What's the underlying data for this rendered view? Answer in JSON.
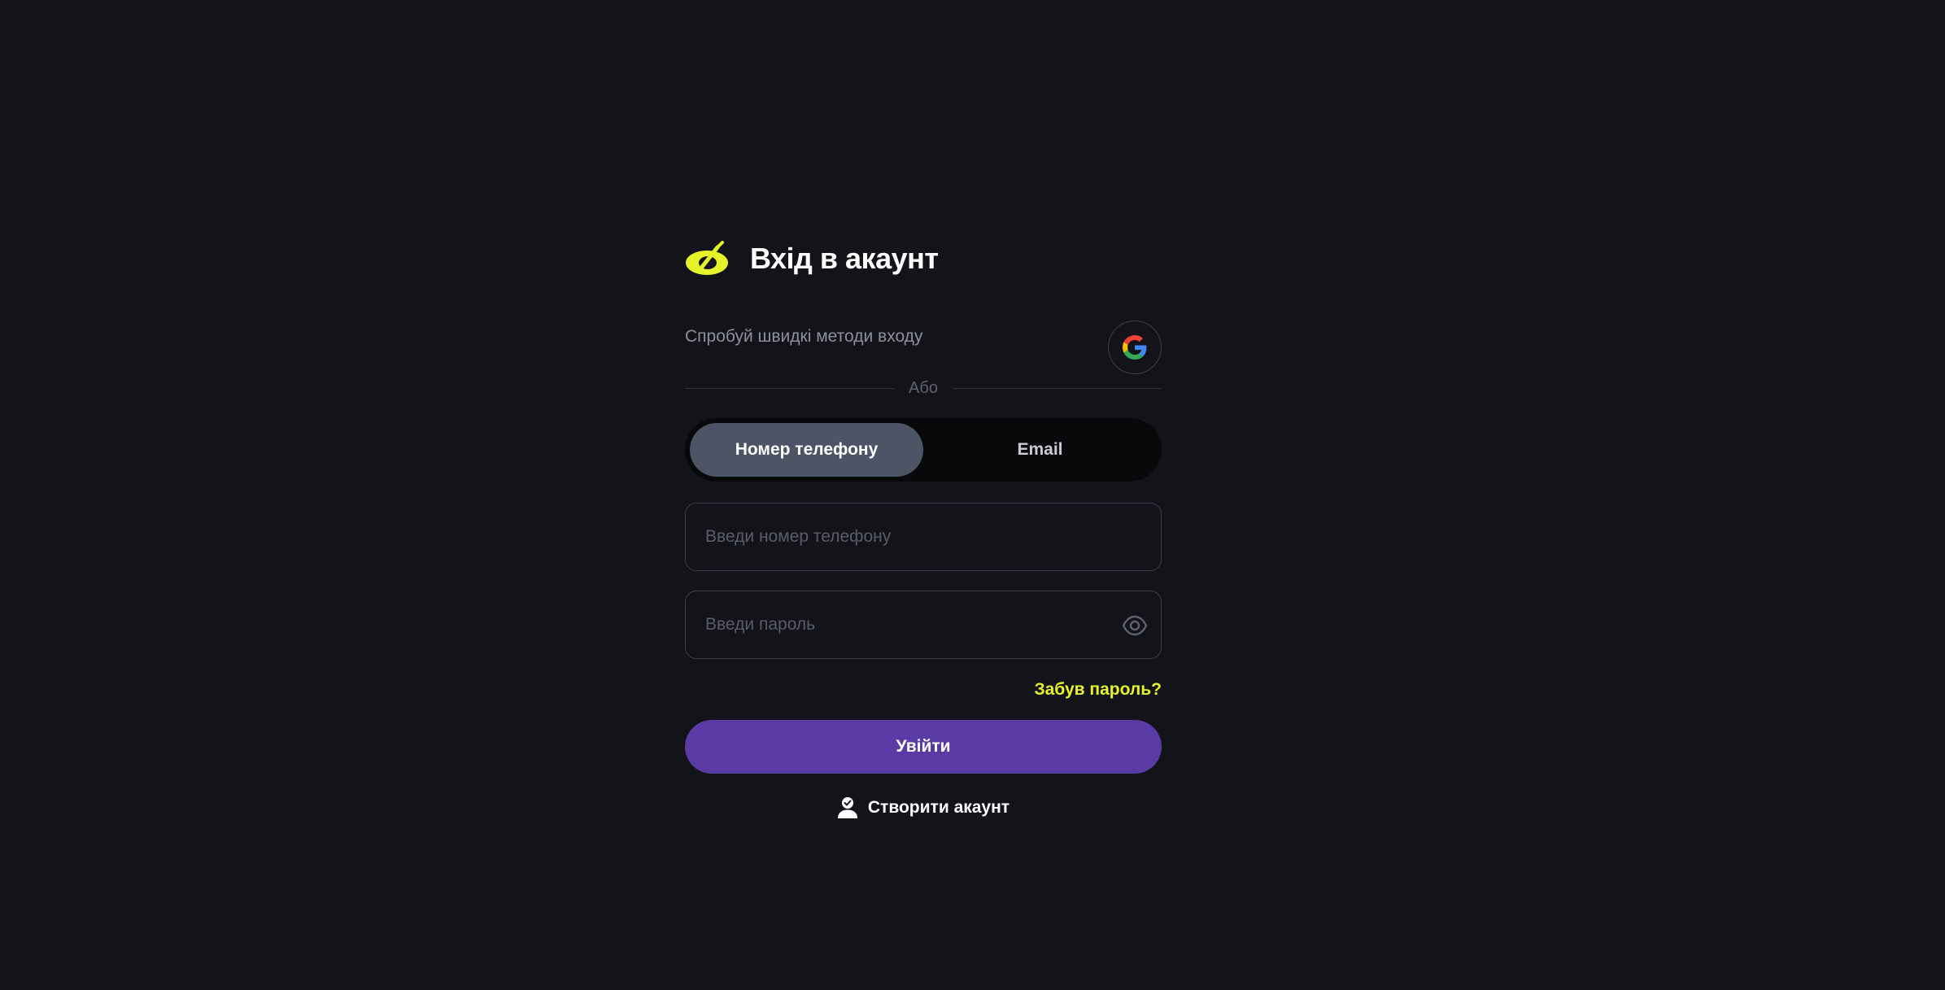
{
  "colors": {
    "background": "#13141a",
    "brand_yellow": "#e6f32a",
    "primary_button": "#5a3aa4",
    "active_tab": "#4d5466"
  },
  "header": {
    "logo_icon": "olive-logo-icon",
    "title": "Вхід в акаунт"
  },
  "quick_login": {
    "text": "Спробуй швидкі методи входу",
    "google_icon": "google-icon"
  },
  "divider": {
    "label": "Або"
  },
  "tabs": [
    {
      "label": "Номер телефону",
      "active": true
    },
    {
      "label": "Email",
      "active": false
    }
  ],
  "phone_field": {
    "value": "",
    "placeholder": "Введи номер телефону"
  },
  "password_field": {
    "value": "",
    "placeholder": "Введи пароль",
    "toggle_icon": "eye-icon"
  },
  "forgot_password": {
    "label": "Забув пароль?"
  },
  "submit": {
    "label": "Увійти"
  },
  "create_account": {
    "icon": "user-check-icon",
    "label": "Створити акаунт"
  }
}
